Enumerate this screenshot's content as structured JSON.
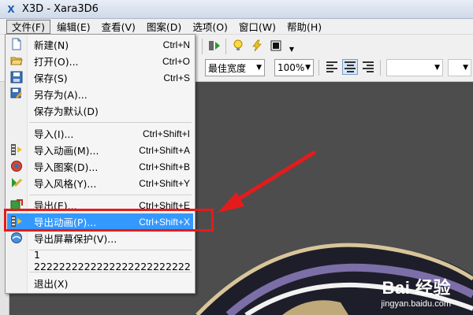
{
  "window": {
    "title": "X3D - Xara3D6",
    "app_icon": "X"
  },
  "menubar": [
    {
      "label": "文件(F)",
      "active": true
    },
    {
      "label": "编辑(E)"
    },
    {
      "label": "查看(V)"
    },
    {
      "label": "图案(D)"
    },
    {
      "label": "选项(O)"
    },
    {
      "label": "窗口(W)"
    },
    {
      "label": "帮助(H)"
    }
  ],
  "toolbar": {
    "font_width": "最佳宽度",
    "zoom": "100%"
  },
  "file_menu": {
    "items": [
      {
        "label": "新建(N)",
        "shortcut": "Ctrl+N",
        "icon": "new-file-icon"
      },
      {
        "label": "打开(O)...",
        "shortcut": "Ctrl+O",
        "icon": "open-folder-icon"
      },
      {
        "label": "保存(S)",
        "shortcut": "Ctrl+S",
        "icon": "save-disk-icon"
      },
      {
        "label": "另存为(A)...",
        "shortcut": "",
        "icon": "save-as-icon"
      },
      {
        "label": "保存为默认(D)",
        "shortcut": "",
        "icon": ""
      },
      {
        "label": "导入(I)...",
        "shortcut": "Ctrl+Shift+I",
        "icon": ""
      },
      {
        "label": "导入动画(M)...",
        "shortcut": "Ctrl+Shift+A",
        "icon": "import-animation-icon"
      },
      {
        "label": "导入图案(D)...",
        "shortcut": "Ctrl+Shift+B",
        "icon": "import-design-icon"
      },
      {
        "label": "导入风格(Y)...",
        "shortcut": "Ctrl+Shift+Y",
        "icon": "import-style-icon"
      },
      {
        "label": "导出(E)...",
        "shortcut": "Ctrl+Shift+E",
        "icon": "export-icon"
      },
      {
        "label": "导出动画(P)...",
        "shortcut": "Ctrl+Shift+X",
        "icon": "export-animation-icon"
      },
      {
        "label": "导出屏幕保护(V)...",
        "shortcut": "",
        "icon": "export-screensaver-icon"
      },
      {
        "label": "1 2222222222222222222222222",
        "shortcut": "",
        "icon": ""
      },
      {
        "label": "退出(X)",
        "shortcut": "",
        "icon": ""
      }
    ],
    "highlighted": "导出动画(P)..."
  },
  "watermark": {
    "logo": "Bai 经验",
    "url": "jingyan.baidu.com"
  },
  "colors": {
    "highlight": "#3399ff",
    "annotation_red": "#e51b1b",
    "canvas": "#4d4d4d"
  }
}
